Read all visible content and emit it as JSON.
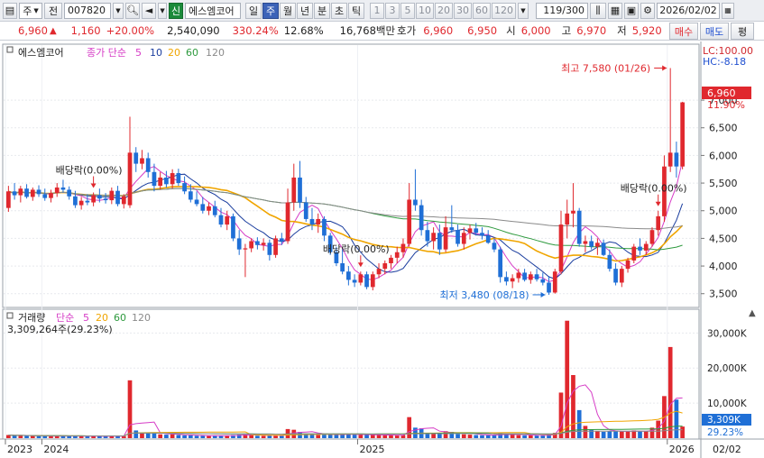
{
  "toolbar": {
    "market_label": "주",
    "prev_label": "전",
    "code": "007820",
    "credit_badge": "신",
    "stock_name": "에스엠코어",
    "periods": [
      "일",
      "주",
      "월",
      "년",
      "분",
      "초",
      "틱"
    ],
    "selected_period": "주",
    "intervals": [
      "1",
      "3",
      "5",
      "10",
      "20",
      "30",
      "60",
      "120"
    ],
    "page_counter": "119/300",
    "date": "2026/02/02"
  },
  "quote": {
    "price": "6,960",
    "change": "1,160",
    "change_pct": "+20.00%",
    "volume": "2,540,090",
    "volume_ratio": "330.24%",
    "turnover_rate": "12.68%",
    "trade_value": "16,768백만",
    "bid_label": "호가",
    "ask_price": "6,960",
    "bid_price": "6,950",
    "open_label": "시",
    "open": "6,000",
    "high_label": "고",
    "high": "6,970",
    "low_label": "저",
    "low": "5,920",
    "buy_label": "매수",
    "sell_label": "매도",
    "eval_label": "평"
  },
  "price_panel": {
    "stock_name": "에스엠코어",
    "ma_title": "종가 단순",
    "ma_periods": [
      "5",
      "10",
      "20",
      "60",
      "120"
    ],
    "lc": "LC:100.00",
    "hc": "HC:-8.18",
    "current_price_tag": "6,960",
    "current_pct_tag": "11.90%",
    "high_annotation": "최고 7,580 (01/26)",
    "low_annotation": "최저 3,480 (08/18)",
    "dividend_labels": [
      "배당락(0.00%)",
      "배당락(0.00%)",
      "배당락(0.00%)"
    ],
    "y_ticks": [
      "7,000",
      "6,500",
      "6,000",
      "5,500",
      "5,000",
      "4,500",
      "4,000",
      "3,500"
    ]
  },
  "volume_panel": {
    "title": "거래량",
    "ma_title": "단순",
    "ma_periods": [
      "5",
      "20",
      "60",
      "120"
    ],
    "current_volume": "3,309,264주(29.23%)",
    "current_volume_tag": "3,309K",
    "current_pct_tag": "29.23%",
    "y_ticks": [
      "30,000K",
      "20,000K",
      "10,000K"
    ]
  },
  "x_axis": {
    "labels": [
      "2023",
      "2024",
      "2025",
      "2026"
    ],
    "end_date": "02/02"
  },
  "colors": {
    "up": "#e0282e",
    "down": "#1f6fd6",
    "ma5": "#d63cc6",
    "ma10": "#1a3d9e",
    "ma20": "#f0a500",
    "ma60": "#2e9a3e",
    "ma120": "#8a8a8a"
  },
  "chart_data": {
    "type": "candlestick",
    "y_range": [
      3300,
      7800
    ],
    "volume_range_k": [
      0,
      36000
    ],
    "highlights": [
      {
        "label": "최고",
        "value": 7580,
        "date": "01/26"
      },
      {
        "label": "최저",
        "value": 3480,
        "date": "08/18"
      }
    ],
    "candles": [
      {
        "o": 5050,
        "h": 5450,
        "l": 4980,
        "c": 5350,
        "v": 900
      },
      {
        "o": 5350,
        "h": 5500,
        "l": 5200,
        "c": 5280,
        "v": 700
      },
      {
        "o": 5280,
        "h": 5450,
        "l": 5150,
        "c": 5400,
        "v": 800
      },
      {
        "o": 5400,
        "h": 5480,
        "l": 5220,
        "c": 5250,
        "v": 700
      },
      {
        "o": 5250,
        "h": 5420,
        "l": 5180,
        "c": 5380,
        "v": 650
      },
      {
        "o": 5380,
        "h": 5460,
        "l": 5250,
        "c": 5300,
        "v": 600
      },
      {
        "o": 5300,
        "h": 5400,
        "l": 5180,
        "c": 5230,
        "v": 600
      },
      {
        "o": 5230,
        "h": 5380,
        "l": 5150,
        "c": 5320,
        "v": 550
      },
      {
        "o": 5320,
        "h": 5500,
        "l": 5250,
        "c": 5420,
        "v": 700
      },
      {
        "o": 5420,
        "h": 5560,
        "l": 5330,
        "c": 5380,
        "v": 650
      },
      {
        "o": 5380,
        "h": 5440,
        "l": 5200,
        "c": 5260,
        "v": 600
      },
      {
        "o": 5260,
        "h": 5360,
        "l": 5050,
        "c": 5100,
        "v": 650
      },
      {
        "o": 5100,
        "h": 5250,
        "l": 5020,
        "c": 5180,
        "v": 550
      },
      {
        "o": 5180,
        "h": 5300,
        "l": 5100,
        "c": 5150,
        "v": 500
      },
      {
        "o": 5150,
        "h": 5330,
        "l": 5080,
        "c": 5280,
        "v": 600
      },
      {
        "o": 5280,
        "h": 5400,
        "l": 5150,
        "c": 5220,
        "v": 550
      },
      {
        "o": 5220,
        "h": 5320,
        "l": 5130,
        "c": 5190,
        "v": 500
      },
      {
        "o": 5190,
        "h": 5420,
        "l": 5120,
        "c": 5360,
        "v": 650
      },
      {
        "o": 5360,
        "h": 5450,
        "l": 5080,
        "c": 5120,
        "v": 700
      },
      {
        "o": 5120,
        "h": 5300,
        "l": 5040,
        "c": 5260,
        "v": 600
      },
      {
        "o": 5100,
        "h": 6700,
        "l": 5050,
        "c": 6050,
        "v": 16500
      },
      {
        "o": 6050,
        "h": 6150,
        "l": 5700,
        "c": 5850,
        "v": 2200
      },
      {
        "o": 5850,
        "h": 6100,
        "l": 5750,
        "c": 5950,
        "v": 1600
      },
      {
        "o": 5950,
        "h": 6050,
        "l": 5600,
        "c": 5700,
        "v": 1400
      },
      {
        "o": 5700,
        "h": 5850,
        "l": 5350,
        "c": 5450,
        "v": 1300
      },
      {
        "o": 5450,
        "h": 5700,
        "l": 5380,
        "c": 5600,
        "v": 1100
      },
      {
        "o": 5600,
        "h": 5720,
        "l": 5420,
        "c": 5480,
        "v": 1000
      },
      {
        "o": 5480,
        "h": 5750,
        "l": 5400,
        "c": 5680,
        "v": 1100
      },
      {
        "o": 5680,
        "h": 5760,
        "l": 5450,
        "c": 5500,
        "v": 900
      },
      {
        "o": 5500,
        "h": 5620,
        "l": 5300,
        "c": 5350,
        "v": 800
      },
      {
        "o": 5350,
        "h": 5480,
        "l": 5150,
        "c": 5200,
        "v": 800
      },
      {
        "o": 5200,
        "h": 5350,
        "l": 5080,
        "c": 5120,
        "v": 700
      },
      {
        "o": 5120,
        "h": 5250,
        "l": 4950,
        "c": 5000,
        "v": 700
      },
      {
        "o": 5000,
        "h": 5150,
        "l": 4920,
        "c": 5080,
        "v": 650
      },
      {
        "o": 5080,
        "h": 5180,
        "l": 4880,
        "c": 4920,
        "v": 650
      },
      {
        "o": 4920,
        "h": 5050,
        "l": 4700,
        "c": 4750,
        "v": 750
      },
      {
        "o": 4750,
        "h": 5000,
        "l": 4650,
        "c": 4900,
        "v": 700
      },
      {
        "o": 4900,
        "h": 4950,
        "l": 4450,
        "c": 4500,
        "v": 900
      },
      {
        "o": 4500,
        "h": 4650,
        "l": 4200,
        "c": 4300,
        "v": 1000
      },
      {
        "o": 4300,
        "h": 4400,
        "l": 3800,
        "c": 4320,
        "v": 1100
      },
      {
        "o": 4320,
        "h": 4500,
        "l": 4250,
        "c": 4450,
        "v": 800
      },
      {
        "o": 4450,
        "h": 4520,
        "l": 4300,
        "c": 4380,
        "v": 700
      },
      {
        "o": 4380,
        "h": 4500,
        "l": 4280,
        "c": 4420,
        "v": 650
      },
      {
        "o": 4420,
        "h": 4480,
        "l": 4100,
        "c": 4200,
        "v": 800
      },
      {
        "o": 4200,
        "h": 4550,
        "l": 4150,
        "c": 4500,
        "v": 900
      },
      {
        "o": 4500,
        "h": 4600,
        "l": 4380,
        "c": 4450,
        "v": 700
      },
      {
        "o": 4450,
        "h": 5400,
        "l": 4400,
        "c": 5150,
        "v": 2600
      },
      {
        "o": 5150,
        "h": 5850,
        "l": 5000,
        "c": 5600,
        "v": 2400
      },
      {
        "o": 5600,
        "h": 5900,
        "l": 5050,
        "c": 5150,
        "v": 1800
      },
      {
        "o": 5150,
        "h": 5250,
        "l": 4800,
        "c": 4850,
        "v": 1300
      },
      {
        "o": 4850,
        "h": 5050,
        "l": 4650,
        "c": 4750,
        "v": 1100
      },
      {
        "o": 4750,
        "h": 4950,
        "l": 4600,
        "c": 4850,
        "v": 900
      },
      {
        "o": 4850,
        "h": 4900,
        "l": 4450,
        "c": 4550,
        "v": 1000
      },
      {
        "o": 4550,
        "h": 4600,
        "l": 4200,
        "c": 4250,
        "v": 1100
      },
      {
        "o": 4250,
        "h": 4350,
        "l": 4000,
        "c": 4050,
        "v": 1000
      },
      {
        "o": 4050,
        "h": 4300,
        "l": 3850,
        "c": 3900,
        "v": 1200
      },
      {
        "o": 3900,
        "h": 4000,
        "l": 3650,
        "c": 3750,
        "v": 1100
      },
      {
        "o": 3750,
        "h": 3850,
        "l": 3620,
        "c": 3700,
        "v": 1000
      },
      {
        "o": 3700,
        "h": 3900,
        "l": 3650,
        "c": 3850,
        "v": 900
      },
      {
        "o": 3850,
        "h": 3900,
        "l": 3580,
        "c": 3620,
        "v": 1000
      },
      {
        "o": 3620,
        "h": 3900,
        "l": 3560,
        "c": 3850,
        "v": 900
      },
      {
        "o": 3850,
        "h": 4050,
        "l": 3780,
        "c": 3950,
        "v": 900
      },
      {
        "o": 3950,
        "h": 4100,
        "l": 3850,
        "c": 4050,
        "v": 850
      },
      {
        "o": 4050,
        "h": 4200,
        "l": 3950,
        "c": 4150,
        "v": 800
      },
      {
        "o": 4150,
        "h": 4350,
        "l": 4050,
        "c": 4250,
        "v": 850
      },
      {
        "o": 4250,
        "h": 4500,
        "l": 4150,
        "c": 4400,
        "v": 900
      },
      {
        "o": 4400,
        "h": 5500,
        "l": 4350,
        "c": 5200,
        "v": 6000
      },
      {
        "o": 5200,
        "h": 5750,
        "l": 5000,
        "c": 5100,
        "v": 3000
      },
      {
        "o": 5100,
        "h": 5200,
        "l": 4550,
        "c": 4650,
        "v": 2800
      },
      {
        "o": 4650,
        "h": 4800,
        "l": 4350,
        "c": 4450,
        "v": 1500
      },
      {
        "o": 4450,
        "h": 4700,
        "l": 4300,
        "c": 4600,
        "v": 1300
      },
      {
        "o": 4600,
        "h": 4750,
        "l": 4200,
        "c": 4300,
        "v": 1400
      },
      {
        "o": 4300,
        "h": 4900,
        "l": 4250,
        "c": 4700,
        "v": 2000
      },
      {
        "o": 4700,
        "h": 5100,
        "l": 4600,
        "c": 4650,
        "v": 1800
      },
      {
        "o": 4650,
        "h": 4750,
        "l": 4350,
        "c": 4400,
        "v": 1200
      },
      {
        "o": 4400,
        "h": 4700,
        "l": 4300,
        "c": 4600,
        "v": 1100
      },
      {
        "o": 4600,
        "h": 4750,
        "l": 4480,
        "c": 4680,
        "v": 1000
      },
      {
        "o": 4680,
        "h": 4780,
        "l": 4550,
        "c": 4600,
        "v": 900
      },
      {
        "o": 4600,
        "h": 4700,
        "l": 4480,
        "c": 4550,
        "v": 800
      },
      {
        "o": 4550,
        "h": 4650,
        "l": 4400,
        "c": 4420,
        "v": 800
      },
      {
        "o": 4420,
        "h": 4500,
        "l": 4250,
        "c": 4300,
        "v": 900
      },
      {
        "o": 4300,
        "h": 4350,
        "l": 3700,
        "c": 3800,
        "v": 1500
      },
      {
        "o": 3800,
        "h": 3900,
        "l": 3650,
        "c": 3720,
        "v": 1100
      },
      {
        "o": 3720,
        "h": 3850,
        "l": 3600,
        "c": 3780,
        "v": 900
      },
      {
        "o": 3780,
        "h": 3950,
        "l": 3700,
        "c": 3880,
        "v": 850
      },
      {
        "o": 3880,
        "h": 3950,
        "l": 3720,
        "c": 3750,
        "v": 800
      },
      {
        "o": 3750,
        "h": 3900,
        "l": 3680,
        "c": 3850,
        "v": 800
      },
      {
        "o": 3850,
        "h": 3950,
        "l": 3720,
        "c": 3760,
        "v": 750
      },
      {
        "o": 3760,
        "h": 3880,
        "l": 3650,
        "c": 3700,
        "v": 800
      },
      {
        "o": 3700,
        "h": 3820,
        "l": 3480,
        "c": 3520,
        "v": 1100
      },
      {
        "o": 3520,
        "h": 3950,
        "l": 3500,
        "c": 3900,
        "v": 1500
      },
      {
        "o": 3900,
        "h": 5000,
        "l": 3850,
        "c": 4750,
        "v": 13000
      },
      {
        "o": 4750,
        "h": 5200,
        "l": 4500,
        "c": 4950,
        "v": 33500
      },
      {
        "o": 4950,
        "h": 5500,
        "l": 4700,
        "c": 5000,
        "v": 18000
      },
      {
        "o": 5000,
        "h": 5050,
        "l": 4350,
        "c": 4400,
        "v": 8000
      },
      {
        "o": 4400,
        "h": 4550,
        "l": 4250,
        "c": 4450,
        "v": 3500
      },
      {
        "o": 4450,
        "h": 4550,
        "l": 4300,
        "c": 4350,
        "v": 2500
      },
      {
        "o": 4350,
        "h": 4500,
        "l": 4200,
        "c": 4420,
        "v": 2000
      },
      {
        "o": 4420,
        "h": 4480,
        "l": 4180,
        "c": 4200,
        "v": 1800
      },
      {
        "o": 4200,
        "h": 4300,
        "l": 3900,
        "c": 3950,
        "v": 2000
      },
      {
        "o": 3950,
        "h": 4050,
        "l": 3650,
        "c": 3700,
        "v": 2100
      },
      {
        "o": 3700,
        "h": 4000,
        "l": 3620,
        "c": 3950,
        "v": 1900
      },
      {
        "o": 3950,
        "h": 4150,
        "l": 3880,
        "c": 4100,
        "v": 1800
      },
      {
        "o": 4100,
        "h": 4400,
        "l": 4050,
        "c": 4350,
        "v": 2200
      },
      {
        "o": 4350,
        "h": 4500,
        "l": 4200,
        "c": 4280,
        "v": 1900
      },
      {
        "o": 4280,
        "h": 4450,
        "l": 4200,
        "c": 4400,
        "v": 2000
      },
      {
        "o": 4400,
        "h": 4700,
        "l": 4350,
        "c": 4650,
        "v": 3000
      },
      {
        "o": 4650,
        "h": 5000,
        "l": 4550,
        "c": 4900,
        "v": 5000
      },
      {
        "o": 4900,
        "h": 6000,
        "l": 4800,
        "c": 5800,
        "v": 12000
      },
      {
        "o": 5800,
        "h": 7580,
        "l": 5700,
        "c": 6050,
        "v": 26000
      },
      {
        "o": 6050,
        "h": 6250,
        "l": 5600,
        "c": 5800,
        "v": 11000
      },
      {
        "o": 5800,
        "h": 6970,
        "l": 5750,
        "c": 6960,
        "v": 3309
      }
    ]
  }
}
